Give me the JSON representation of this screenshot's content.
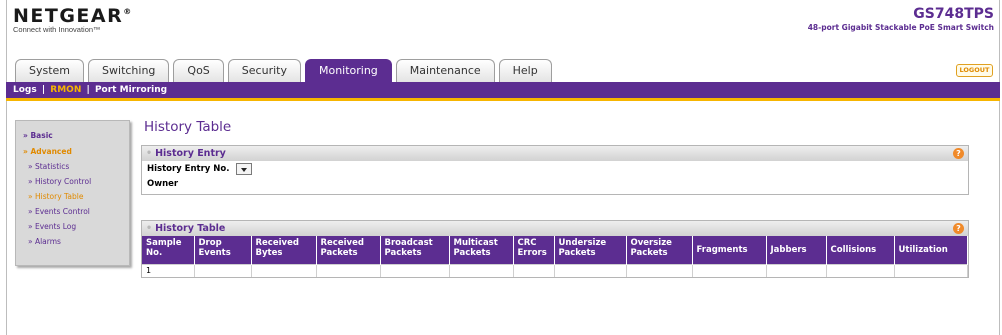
{
  "header": {
    "brand": "NETGEAR",
    "brand_mark": "®",
    "tagline": "Connect with Innovation™",
    "model": "GS748TPS",
    "model_desc": "48-port Gigabit Stackable PoE Smart Switch"
  },
  "tabs": [
    "System",
    "Switching",
    "QoS",
    "Security",
    "Monitoring",
    "Maintenance",
    "Help"
  ],
  "active_tab": "Monitoring",
  "logout_label": "LOGOUT",
  "subnav": {
    "logs": "Logs",
    "rmon": "RMON",
    "port_mirroring": "Port Mirroring",
    "sep": "|"
  },
  "sidebar": {
    "basic": "» Basic",
    "advanced": "» Advanced",
    "items": [
      "» Statistics",
      "» History Control",
      "» History Table",
      "» Events Control",
      "» Events Log",
      "» Alarms"
    ]
  },
  "page_title": "History Table",
  "history_entry": {
    "title": "History Entry",
    "entry_no_label": "History Entry No.",
    "owner_label": "Owner"
  },
  "history_table": {
    "title": "History Table",
    "columns": [
      "Sample No.",
      "Drop Events",
      "Received Bytes",
      "Received Packets",
      "Broadcast Packets",
      "Multicast Packets",
      "CRC Errors",
      "Undersize Packets",
      "Oversize Packets",
      "Fragments",
      "Jabbers",
      "Collisions",
      "Utilization"
    ],
    "rows": [
      [
        "1",
        "",
        "",
        "",
        "",
        "",
        "",
        "",
        "",
        "",
        "",
        "",
        ""
      ]
    ]
  },
  "help_icon": "?",
  "section_bullet": "•",
  "colors": {
    "brand_purple": "#5c2d91",
    "accent_orange": "#f7b500",
    "help_orange": "#f08a2a"
  }
}
